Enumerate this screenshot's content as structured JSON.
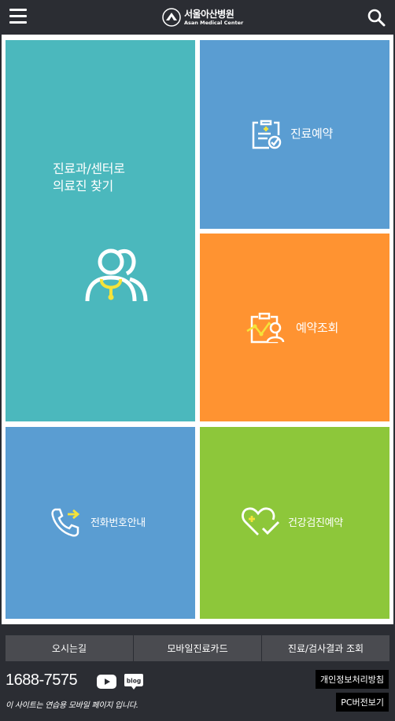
{
  "header": {
    "logo_ko": "서울아산병원",
    "logo_en": "Asan Medical Center"
  },
  "tiles": [
    {
      "label": "진료과/센터로\n의료진 찾기",
      "color": "#4bb8bd",
      "icon": "doctor-stethoscope-icon"
    },
    {
      "label": "진료예약",
      "color": "#5a9dd2",
      "icon": "clipboard-check-icon"
    },
    {
      "label": "예약조회",
      "color": "#ff9331",
      "icon": "reservation-lookup-icon"
    },
    {
      "label": "전화번호안내",
      "color": "#5a9dd2",
      "icon": "phone-forward-icon"
    },
    {
      "label": "건강검진예약",
      "color": "#8dc73a",
      "icon": "heart-check-icon"
    }
  ],
  "footer": {
    "quick_links": [
      "오시는길",
      "모바일진료카드",
      "진료/검사결과 조회"
    ],
    "phone": "1688-7575",
    "notice": "이 사이트는 연습용 모바일 페이지 입니다.",
    "privacy": "개인정보처리방침",
    "pc_version": "PC버전보기"
  },
  "colors": {
    "background": "#2b2d33",
    "teal": "#4bb8bd",
    "blue": "#5a9dd2",
    "orange": "#ff9331",
    "green": "#8dc73a",
    "accent_yellow": "#f5e33a"
  }
}
